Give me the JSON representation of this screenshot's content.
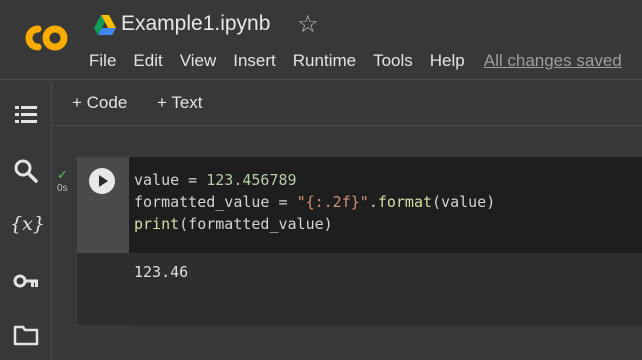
{
  "header": {
    "title": "Example1.ipynb",
    "menu": [
      "File",
      "Edit",
      "View",
      "Insert",
      "Runtime",
      "Tools",
      "Help"
    ],
    "saved_status": "All changes saved"
  },
  "toolbar": {
    "add_code_label": "+ Code",
    "add_text_label": "+ Text"
  },
  "sidebar": {
    "icons": [
      "table-of-contents-icon",
      "search-icon",
      "variables-icon",
      "key-icon",
      "folder-icon"
    ],
    "variables_label": "{x}"
  },
  "cell": {
    "exec_time": "0s",
    "code_lines": [
      "value = 123.456789",
      "formatted_value = \"{:.2f}\".format(value)",
      "print(formatted_value)"
    ],
    "output": "123.46"
  },
  "colors": {
    "background": "#383838",
    "code_bg": "#1e1e1e",
    "logo_orange": "#f9ab00",
    "check_green": "#5fc35f"
  }
}
